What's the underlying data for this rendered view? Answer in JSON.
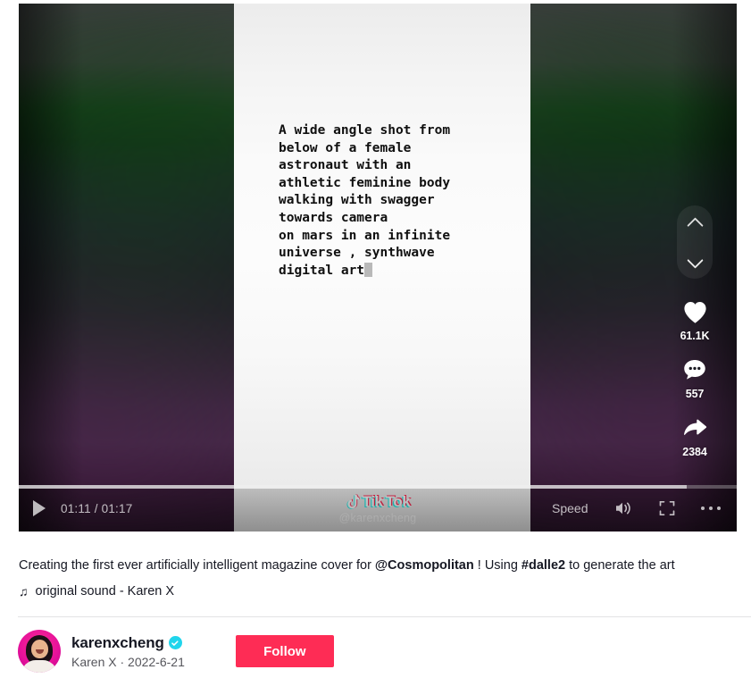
{
  "video": {
    "prompt_text": "A wide angle shot from\nbelow of a female\nastronaut with an\nathletic feminine body\nwalking with swagger\ntowards camera\non mars in an infinite\nuniverse , synthwave\ndigital art",
    "watermark_brand_tik": "Tik",
    "watermark_brand_tok": "Tok",
    "watermark_handle": "@karenxcheng"
  },
  "actions": {
    "prev_icon": "chevron-up-icon",
    "next_icon": "chevron-down-icon",
    "like": {
      "icon": "heart-icon",
      "count": "61.1K"
    },
    "comment": {
      "icon": "comment-icon",
      "count": "557"
    },
    "share": {
      "icon": "share-arrow-icon",
      "count": "2384"
    }
  },
  "controls": {
    "play_icon": "play-icon",
    "time": "01:11 / 01:17",
    "current_time": "01:11",
    "duration": "01:17",
    "progress_percent": 93,
    "speed_label": "Speed",
    "volume_icon": "volume-icon",
    "fullscreen_icon": "fullscreen-icon",
    "more_icon": "more-options-icon"
  },
  "caption": {
    "part1": "Creating the first ever artificially intelligent magazine cover for ",
    "mention": "@Cosmopolitan",
    "part2": " ! Using ",
    "hashtag": "#dalle2",
    "part3": " to generate the art",
    "music_note": "♫",
    "music": "original sound - Karen X"
  },
  "author": {
    "username": "karenxcheng",
    "verified_icon": "verified-badge-icon",
    "display_name": "Karen X",
    "separator": " · ",
    "date": "2022-6-21",
    "subline": "Karen X · 2022-6-21",
    "follow_label": "Follow"
  },
  "colors": {
    "brand_red": "#FE2C55",
    "brand_cyan": "#25F4EE",
    "verified_blue": "#20D5EC",
    "text_primary": "#161823",
    "text_secondary": "#56565c"
  }
}
